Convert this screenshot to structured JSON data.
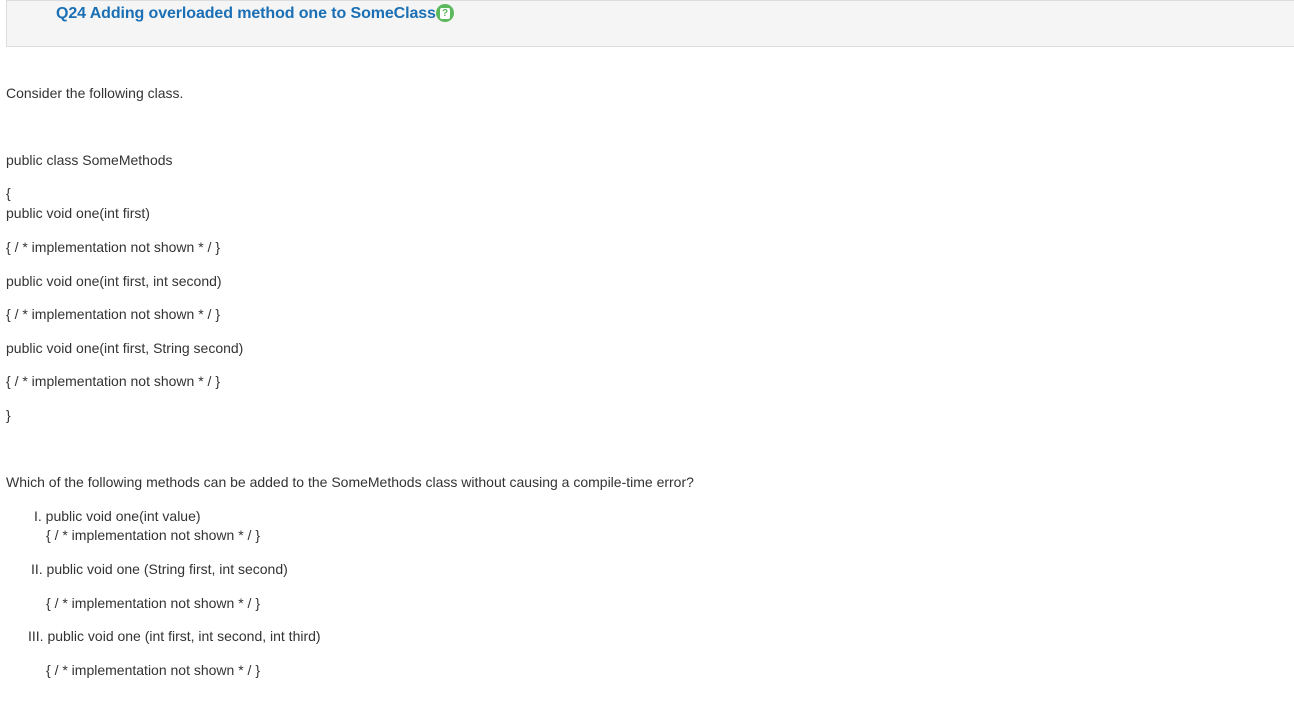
{
  "header": {
    "title": "Q24 Adding overloaded method one to SomeClass",
    "help_glyph": "?"
  },
  "intro": "Consider the following class.",
  "code": [
    "public class SomeMethods",
    "{",
    "public void one(int first)",
    "{ / * implementation not shown * / }",
    "public void one(int first, int second)",
    "{ / * implementation not shown * / }",
    "public void one(int first, String second)",
    "{ / * implementation not shown * / }",
    "}"
  ],
  "question": "Which of the following methods can be added to the SomeMethods class without causing a compile-time error?",
  "options": [
    {
      "signature": "I. public void one(int value)",
      "body": "{ / * implementation not shown * / }"
    },
    {
      "signature": "II. public void one (String first, int second)",
      "body": "{ / * implementation not shown * / }"
    },
    {
      "signature": "III. public void one (int first, int second, int third)",
      "body": "{ / * implementation not shown * / }"
    }
  ],
  "colors": {
    "title": "#1a6fb5",
    "help_icon": "#5cb85c",
    "header_bg": "#f5f5f5",
    "text": "#333333"
  }
}
